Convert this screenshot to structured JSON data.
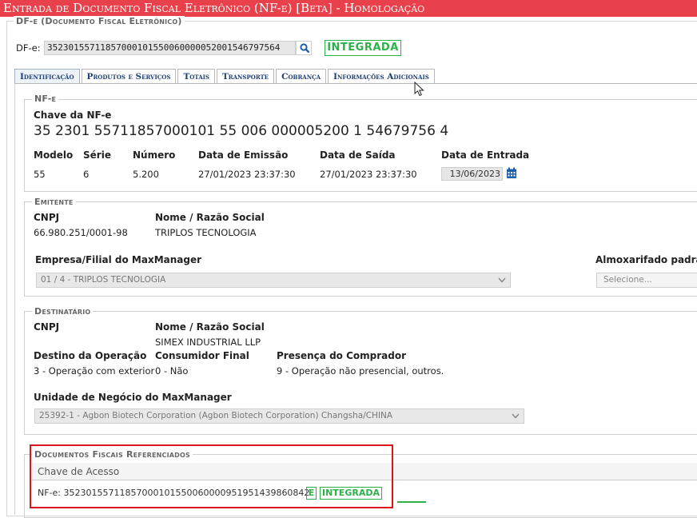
{
  "window": {
    "title": "Entrada de Documento Fiscal Eletrônico (NF-e) [Beta]   - Homologação"
  },
  "dfe": {
    "legend": "DF-e (Documento Fiscal Eletrônico)",
    "label": "DF-e:",
    "value": "35230155711857000101550060000052001546797564",
    "status": "INTEGRADA"
  },
  "tabs": [
    {
      "label": "Identificação",
      "active": true
    },
    {
      "label": "Produtos e Serviços"
    },
    {
      "label": "Totais"
    },
    {
      "label": "Transporte"
    },
    {
      "label": "Cobrança"
    },
    {
      "label": "Informações Adicionais"
    }
  ],
  "nfe": {
    "legend": "NF-e",
    "chave_label": "Chave da NF-e",
    "chave_value": "35 2301 55711857000101 55 006 000005200 1 54679756 4",
    "modelo_label": "Modelo",
    "modelo_value": "55",
    "serie_label": "Série",
    "serie_value": "6",
    "numero_label": "Número",
    "numero_value": "5.200",
    "emissao_label": "Data de Emissão",
    "emissao_value": "27/01/2023 23:37:30",
    "saida_label": "Data de Saída",
    "saida_value": "27/01/2023 23:37:30",
    "entrada_label": "Data de Entrada",
    "entrada_value": "13/06/2023"
  },
  "emitente": {
    "legend": "Emitente",
    "cnpj_label": "CNPJ",
    "cnpj_value": "66.980.251/0001-98",
    "nome_label": "Nome / Razão Social",
    "nome_value": "TRIPLOS TECNOLOGIA",
    "empresa_label": "Empresa/Filial do MaxManager",
    "empresa_value": "01 / 4 - TRIPLOS TECNOLOGIA",
    "almox_label": "Almoxarifado padrão",
    "almox_placeholder": "Selecione..."
  },
  "destinatario": {
    "legend": "Destinatário",
    "cnpj_label": "CNPJ",
    "nome_label": "Nome / Razão Social",
    "nome_value": "SIMEX INDUSTRIAL LLP",
    "destino_label": "Destino da Operação",
    "destino_value": "3 - Operação com exterior",
    "consumidor_label": "Consumidor Final",
    "consumidor_value": "0 - Não",
    "presenca_label": "Presença do Comprador",
    "presenca_value": "9 - Operação não presencial, outros.",
    "unidade_label": "Unidade de Negócio do MaxManager",
    "unidade_value": "25392-1 - Agbon Biotech Corporation (Agbon Biotech Corporation) Changsha/CHINA"
  },
  "referenciados": {
    "legend": "Documentos Fiscais Referenciados",
    "column": "Chave de Acesso",
    "row_text": "NF-e: 35230155711857000101550060000951951439860842",
    "row_badge_e": "E",
    "row_status": "INTEGRADA"
  },
  "colors": {
    "title_bg": "#e8414b",
    "status_green": "#2eb04b",
    "tab_text": "#1d3f78",
    "highlight_red": "#d9141c"
  },
  "icons": {
    "search": "search-icon",
    "calendar": "calendar-icon",
    "chevron": "chevron-down-icon",
    "cursor": "mouse-cursor-icon"
  }
}
